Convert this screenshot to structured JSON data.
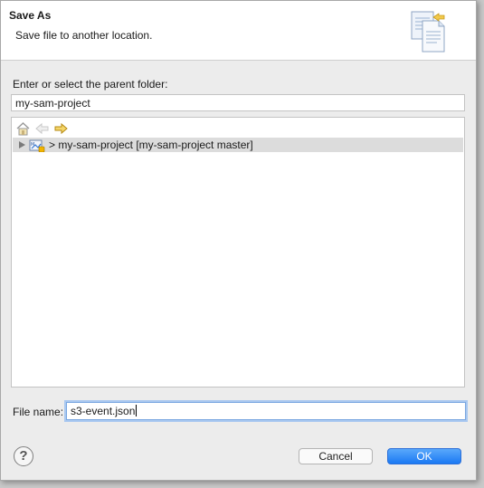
{
  "dialog": {
    "title": "Save As",
    "description": "Save file to another location."
  },
  "parent_folder": {
    "label": "Enter or select the parent folder:",
    "value": "my-sam-project"
  },
  "tree": {
    "toolbar": [
      "home-icon",
      "back-arrow-icon",
      "forward-arrow-icon"
    ],
    "items": [
      {
        "label": "> my-sam-project [my-sam-project master]",
        "expanded": false,
        "selected": true
      }
    ]
  },
  "file_name": {
    "label": "File name:",
    "value": "s3-event.json"
  },
  "buttons": {
    "help": "?",
    "cancel": "Cancel",
    "ok": "OK"
  },
  "colors": {
    "primary_button": "#1a79f3",
    "selected_row": "#dcdcdc",
    "focus_ring": "#a9c8f0"
  }
}
